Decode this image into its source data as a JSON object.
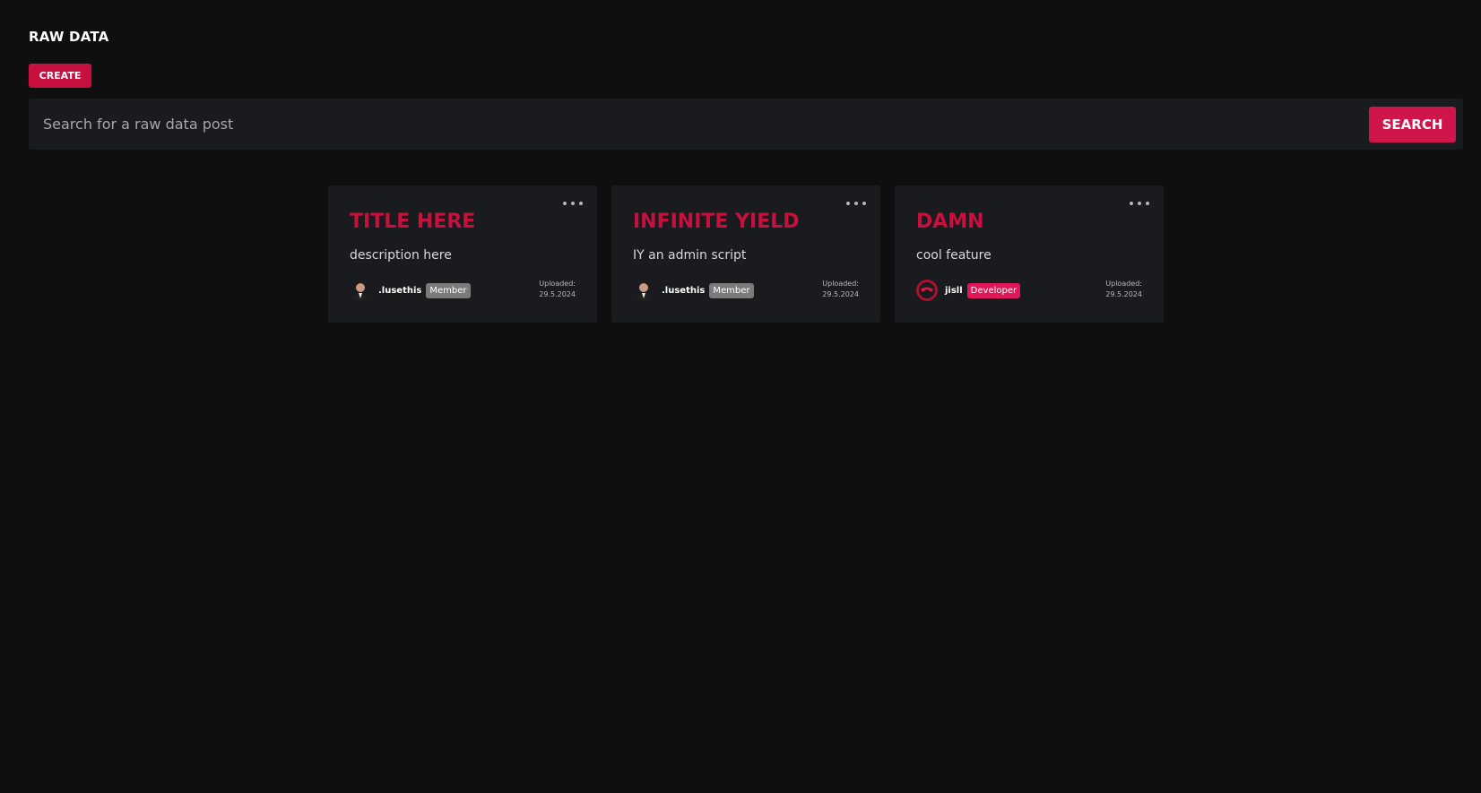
{
  "header": {
    "title": "RAW DATA",
    "create_label": "CREATE"
  },
  "search": {
    "placeholder": "Search for a raw data post",
    "value": "",
    "button_label": "SEARCH"
  },
  "colors": {
    "accent": "#c8103f",
    "member_badge": "#7a7a7a",
    "developer_badge": "#e0185a",
    "background": "#0f0f10",
    "card_background": "#1a1b1e"
  },
  "posts": [
    {
      "title": "TITLE HERE",
      "description": "description here",
      "author": ".lusethis",
      "role": "Member",
      "avatar_icon": "portrait-avatar-icon",
      "uploaded_label": "Uploaded:",
      "uploaded_date": "29.5.2024"
    },
    {
      "title": "INFINITE YIELD",
      "description": "IY an admin script",
      "author": ".lusethis",
      "role": "Member",
      "avatar_icon": "portrait-avatar-icon",
      "uploaded_label": "Uploaded:",
      "uploaded_date": "29.5.2024"
    },
    {
      "title": "DAMN",
      "description": "cool feature",
      "author": "jisll",
      "role": "Developer",
      "avatar_icon": "red-emblem-avatar-icon",
      "uploaded_label": "Uploaded:",
      "uploaded_date": "29.5.2024"
    }
  ]
}
